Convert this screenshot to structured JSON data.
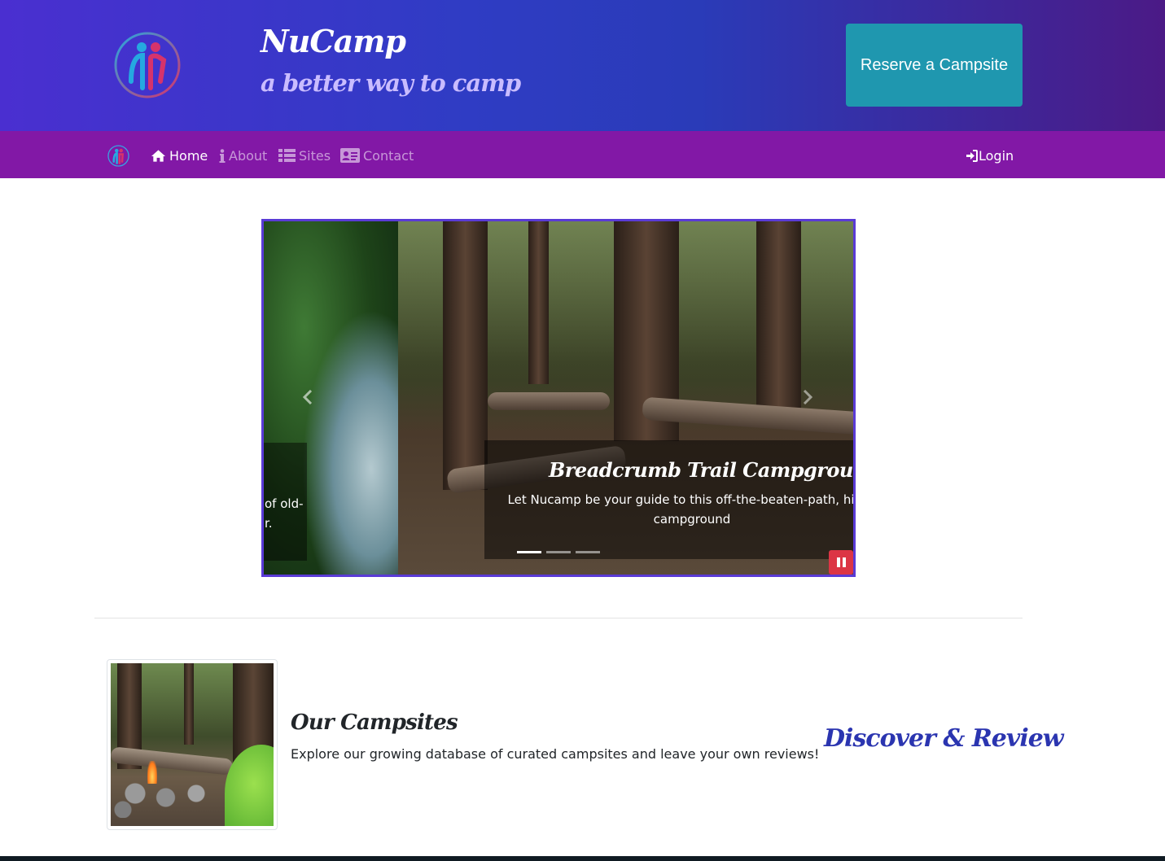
{
  "header": {
    "brand_title": "NuCamp",
    "brand_subtitle": "a better way to camp",
    "reserve_label": "Reserve a Campsite",
    "logo_icon": "nucamp-logo-icon"
  },
  "navbar": {
    "items": [
      {
        "label": "Home",
        "icon": "home-icon",
        "active": true
      },
      {
        "label": "About",
        "icon": "info-icon",
        "active": false
      },
      {
        "label": "Sites",
        "icon": "list-icon",
        "active": false
      },
      {
        "label": "Contact",
        "icon": "address-card-icon",
        "active": false
      }
    ],
    "login_label": "Login",
    "login_icon": "sign-in-icon"
  },
  "carousel": {
    "prev_slide_caption_partial": [
      "of old-",
      "r."
    ],
    "active_slide": {
      "title": "Breadcrumb Trail Campground",
      "text": "Let Nucamp be your guide to this off-the-beaten-path, hike-i campground"
    },
    "indicators": 3,
    "active_indicator": 0
  },
  "media": {
    "title": "Our Campsites",
    "text": "Explore our growing database of curated campsites and leave your own reviews!",
    "tagline": "Discover & Review"
  },
  "colors": {
    "header_start": "#4a2fd0",
    "header_end": "#4b1a86",
    "navbar": "#8218a6",
    "reserve_button": "#1f97af",
    "pause_button": "#dc3545",
    "tagline": "#2b35b0"
  }
}
